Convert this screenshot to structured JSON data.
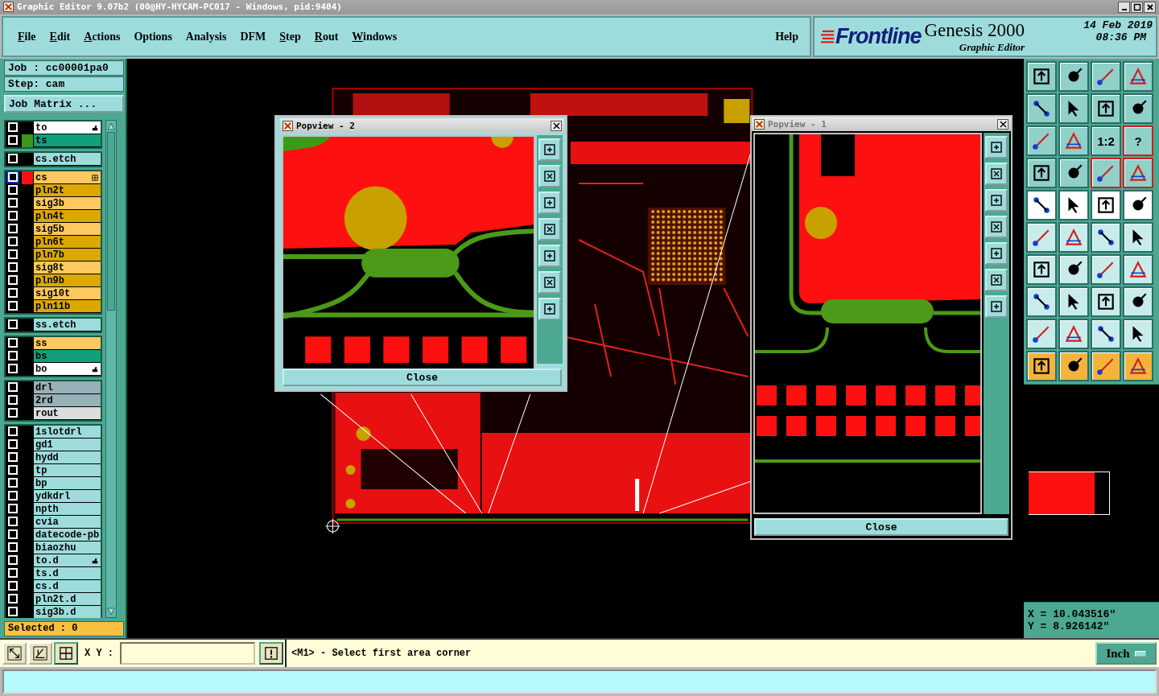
{
  "window": {
    "title": "Graphic Editor 9.07b2 (00@HY-HYCAM-PC017 - Windows, pid:9404)"
  },
  "menu": [
    {
      "label": "File",
      "underline": true
    },
    {
      "label": "Edit",
      "underline": true
    },
    {
      "label": "Actions",
      "underline": true
    },
    {
      "label": "Options",
      "underline": false
    },
    {
      "label": "Analysis",
      "underline": false
    },
    {
      "label": "DFM",
      "underline": false
    },
    {
      "label": "Step",
      "underline": true
    },
    {
      "label": "Rout",
      "underline": true
    },
    {
      "label": "Windows",
      "underline": true
    }
  ],
  "help": "Help",
  "brand": {
    "logo": "Frontline",
    "product": "Genesis 2000",
    "subtitle": "Graphic Editor",
    "date": "14 Feb 2019",
    "time": "08:36 PM"
  },
  "job": {
    "job": "Job : cc00001pa0",
    "step": "Step: cam",
    "matrix_button": "Job Matrix ..."
  },
  "layer_groups": [
    {
      "layers": [
        {
          "name": "to",
          "color": "#ffffff",
          "pointer": true,
          "work_layer": false
        },
        {
          "name": "ts",
          "color": "#12a07c",
          "display": {
            "color": "#3c9a18"
          },
          "pointer": false,
          "work_layer": false
        }
      ]
    },
    {
      "layers": [
        {
          "name": "cs.etch",
          "color": "#9edcdc",
          "pointer": false,
          "work_layer": false
        }
      ]
    },
    {
      "layers": [
        {
          "name": "cs",
          "color": "#ffc860",
          "display": {
            "color": "#ff1010"
          },
          "pointer": false,
          "work_layer": true
        },
        {
          "name": "pln2t",
          "color": "#dca800",
          "pointer": false,
          "work_layer": false
        },
        {
          "name": "sig3b",
          "color": "#ffc860",
          "pointer": false,
          "work_layer": false
        },
        {
          "name": "pln4t",
          "color": "#dca800",
          "pointer": false,
          "work_layer": false
        },
        {
          "name": "sig5b",
          "color": "#ffc860",
          "pointer": false,
          "work_layer": false
        },
        {
          "name": "pln6t",
          "color": "#dca800",
          "pointer": false,
          "work_layer": false
        },
        {
          "name": "pln7b",
          "color": "#dca800",
          "pointer": false,
          "work_layer": false
        },
        {
          "name": "sig8t",
          "color": "#ffc860",
          "pointer": false,
          "work_layer": false
        },
        {
          "name": "pln9b",
          "color": "#dca800",
          "pointer": false,
          "work_layer": false
        },
        {
          "name": "sig10t",
          "color": "#ffc860",
          "pointer": false,
          "work_layer": false
        },
        {
          "name": "pln11b",
          "color": "#dca800",
          "pointer": false,
          "work_layer": false
        }
      ]
    },
    {
      "layers": [
        {
          "name": "ss.etch",
          "color": "#9edcdc",
          "pointer": false,
          "work_layer": false
        }
      ]
    },
    {
      "layers": [
        {
          "name": "ss",
          "color": "#ffc860",
          "pointer": false,
          "work_layer": false
        },
        {
          "name": "bs",
          "color": "#12a07c",
          "pointer": false,
          "work_layer": false
        },
        {
          "name": "bo",
          "color": "#ffffff",
          "pointer": true,
          "work_layer": false
        }
      ]
    },
    {
      "layers": [
        {
          "name": "drl",
          "color": "#98b0b8",
          "pointer": false,
          "work_layer": false
        },
        {
          "name": "2rd",
          "color": "#98b0b8",
          "pointer": false,
          "work_layer": false
        },
        {
          "name": "rout",
          "color": "#dcdcdc",
          "pointer": false,
          "work_layer": false
        }
      ]
    },
    {
      "layers": [
        {
          "name": "1slotdrl",
          "color": "#9edcdc",
          "pointer": false,
          "work_layer": false
        },
        {
          "name": "gd1",
          "color": "#9edcdc",
          "pointer": false,
          "work_layer": false
        },
        {
          "name": "hydd",
          "color": "#9edcdc",
          "pointer": false,
          "work_layer": false
        },
        {
          "name": "tp",
          "color": "#9edcdc",
          "pointer": false,
          "work_layer": false
        },
        {
          "name": "bp",
          "color": "#9edcdc",
          "pointer": false,
          "work_layer": false
        },
        {
          "name": "ydkdrl",
          "color": "#9edcdc",
          "pointer": false,
          "work_layer": false
        },
        {
          "name": "npth",
          "color": "#9edcdc",
          "pointer": false,
          "work_layer": false
        },
        {
          "name": "cvia",
          "color": "#9edcdc",
          "pointer": false,
          "work_layer": false
        },
        {
          "name": "datecode-pb",
          "color": "#9edcdc",
          "pointer": false,
          "work_layer": false
        },
        {
          "name": "biaozhu",
          "color": "#9edcdc",
          "pointer": false,
          "work_layer": false
        },
        {
          "name": "to.d",
          "color": "#9edcdc",
          "pointer": true,
          "work_layer": false
        },
        {
          "name": "ts.d",
          "color": "#9edcdc",
          "pointer": false,
          "work_layer": false
        },
        {
          "name": "cs.d",
          "color": "#9edcdc",
          "pointer": false,
          "work_layer": false
        },
        {
          "name": "pln2t.d",
          "color": "#9edcdc",
          "pointer": false,
          "work_layer": false
        },
        {
          "name": "sig3b.d",
          "color": "#9edcdc",
          "pointer": false,
          "work_layer": false
        }
      ]
    }
  ],
  "selected_count": "Selected : 0",
  "popviews": [
    {
      "title": "Popview - 2",
      "close": "Close",
      "kind": "left"
    },
    {
      "title": "Popview - 1",
      "close": "Close",
      "kind": "right"
    }
  ],
  "tools": [
    {
      "kind": "teal"
    },
    {
      "kind": "teal"
    },
    {
      "kind": "teal"
    },
    {
      "kind": "teal"
    },
    {
      "kind": "teal"
    },
    {
      "kind": "teal"
    },
    {
      "kind": "teal"
    },
    {
      "kind": "teal"
    },
    {
      "kind": "teal"
    },
    {
      "kind": "teal"
    },
    {
      "kind": "teal",
      "label": "1:2"
    },
    {
      "kind": "framed",
      "label": "?"
    },
    {
      "kind": "teal"
    },
    {
      "kind": "teal"
    },
    {
      "kind": "framed"
    },
    {
      "kind": "framed"
    },
    {
      "kind": "white"
    },
    {
      "kind": "white"
    },
    {
      "kind": "white"
    },
    {
      "kind": "white"
    },
    {
      "kind": "light"
    },
    {
      "kind": "light"
    },
    {
      "kind": "light"
    },
    {
      "kind": "light"
    },
    {
      "kind": "light"
    },
    {
      "kind": "light"
    },
    {
      "kind": "light"
    },
    {
      "kind": "light"
    },
    {
      "kind": "light"
    },
    {
      "kind": "light"
    },
    {
      "kind": "light"
    },
    {
      "kind": "light"
    },
    {
      "kind": "light"
    },
    {
      "kind": "light"
    },
    {
      "kind": "light"
    },
    {
      "kind": "light"
    },
    {
      "kind": "orange"
    },
    {
      "kind": "orange"
    },
    {
      "kind": "orange"
    },
    {
      "kind": "orange"
    }
  ],
  "coords": {
    "x": "X = 10.043516\"",
    "y": "Y = 8.926142\""
  },
  "command": {
    "xy_label": "X Y :",
    "prompt": "<M1> - Select first area corner",
    "units": "Inch"
  }
}
